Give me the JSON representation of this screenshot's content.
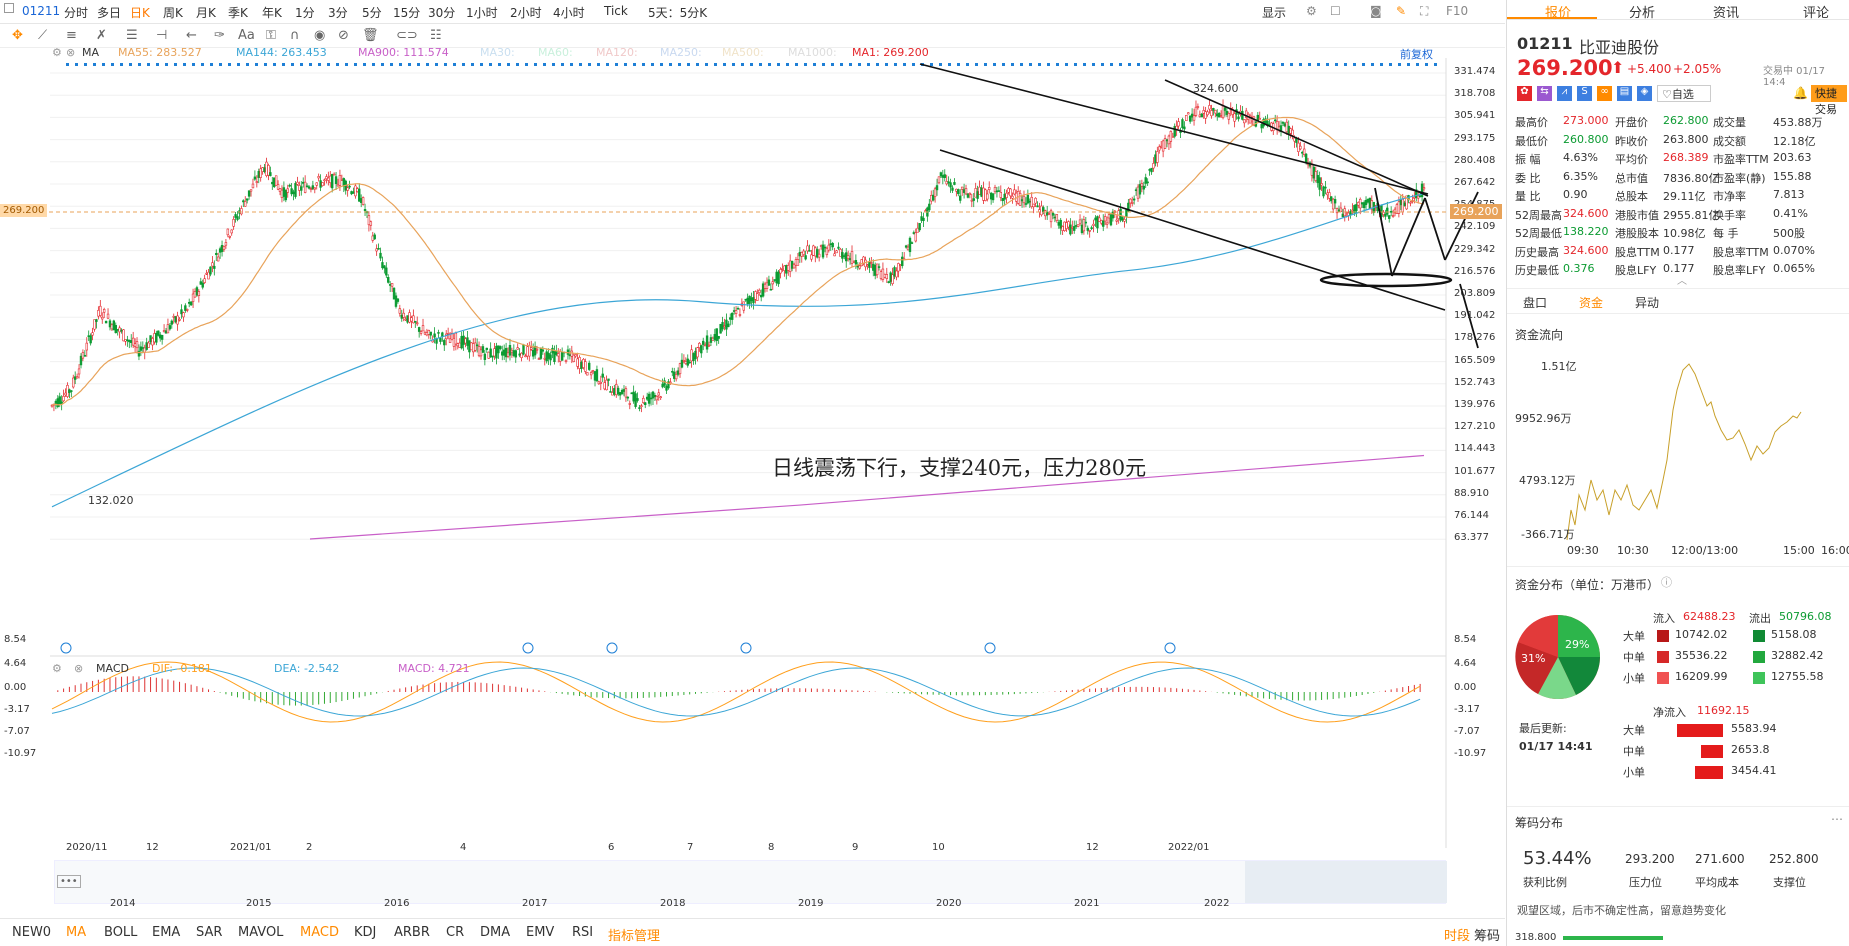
{
  "topbar": {
    "code": "01211",
    "periods": [
      "分时",
      "多日",
      "日K",
      "周K",
      "月K",
      "季K",
      "年K",
      "1分",
      "3分",
      "5分",
      "15分",
      "30分",
      "1小时",
      "2小时",
      "4小时",
      "Tick",
      "5天：5分K"
    ],
    "display_label": "显示",
    "f10": "F10"
  },
  "ma_legend": {
    "ma": "MA",
    "ma55": "MA55: 283.527",
    "ma144": "MA144: 263.453",
    "ma900": "MA900: 111.574",
    "ma30": "MA30:",
    "ma60": "MA60:",
    "ma120": "MA120:",
    "ma250": "MA250:",
    "ma500": "MA500:",
    "ma1000": "MA1000:",
    "ma1": "MA1: 269.200",
    "adjust": "前复权"
  },
  "price_axis": [
    "331.474",
    "318.708",
    "305.941",
    "293.175",
    "280.408",
    "267.642",
    "254.875",
    "242.109",
    "229.342",
    "216.576",
    "203.809",
    "191.042",
    "178.276",
    "165.509",
    "152.743",
    "139.976",
    "127.210",
    "114.443",
    "101.677",
    "88.910",
    "76.144",
    "63.377"
  ],
  "last_price_tag": "269.200",
  "annotations": {
    "high": "324.600",
    "low": "132.020",
    "note": "日线震荡下行，支撑240元，压力280元"
  },
  "macd_legend": {
    "name": "MACD",
    "dif": "DIF: -0.181",
    "dea": "DEA: -2.542",
    "macd": "MACD: 4.721"
  },
  "macd_axis": [
    "8.54",
    "4.64",
    "0.00",
    "-3.17",
    "-7.07",
    "-10.97"
  ],
  "time_axis": [
    "2020/11",
    "12",
    "2021/01",
    "2",
    "4",
    "6",
    "7",
    "8",
    "9",
    "10",
    "12",
    "2022/01"
  ],
  "year_axis": [
    "2014",
    "2015",
    "2016",
    "2017",
    "2018",
    "2019",
    "2020",
    "2021",
    "2022"
  ],
  "indicators": [
    "NEW0",
    "MA",
    "BOLL",
    "EMA",
    "SAR",
    "MAVOL",
    "MACD",
    "KDJ",
    "ARBR",
    "CR",
    "DMA",
    "EMV",
    "RSI",
    "指标管理"
  ],
  "bottom_right": {
    "timeshare": "时段",
    "chips": "筹码"
  },
  "panel": {
    "tabs": [
      "报价",
      "分析",
      "资讯",
      "评论"
    ],
    "code": "01211",
    "name": "比亚迪股份",
    "status": "交易中 01/17 14:4",
    "price": "269.200",
    "arrow": "⬆",
    "change": "+5.400",
    "pct": "+2.05%",
    "watch": "自选",
    "quick_trade": "快捷交易",
    "quotes": [
      [
        [
          "最高价",
          "273.000",
          "red"
        ],
        [
          "开盘价",
          "262.800",
          "green"
        ],
        [
          "成交量",
          "453.88万",
          ""
        ]
      ],
      [
        [
          "最低价",
          "260.800",
          "green"
        ],
        [
          "昨收价",
          "263.800",
          ""
        ],
        [
          "成交额",
          "12.18亿",
          ""
        ]
      ],
      [
        [
          "振  幅",
          "4.63%",
          ""
        ],
        [
          "平均价",
          "268.389",
          "red"
        ],
        [
          "市盈率TTM",
          "203.63",
          ""
        ]
      ],
      [
        [
          "委  比",
          "6.35%",
          ""
        ],
        [
          "总市值",
          "7836.80亿",
          ""
        ],
        [
          "市盈率(静)",
          "155.88",
          ""
        ]
      ],
      [
        [
          "量  比",
          "0.90",
          ""
        ],
        [
          "总股本",
          "29.11亿",
          ""
        ],
        [
          "市净率",
          "7.813",
          ""
        ]
      ],
      [
        [
          "52周最高",
          "324.600",
          "red"
        ],
        [
          "港股市值",
          "2955.81亿",
          ""
        ],
        [
          "换手率",
          "0.41%",
          ""
        ]
      ],
      [
        [
          "52周最低",
          "138.220",
          "green"
        ],
        [
          "港股股本",
          "10.98亿",
          ""
        ],
        [
          "每  手",
          "500股",
          ""
        ]
      ],
      [
        [
          "历史最高",
          "324.600",
          "red"
        ],
        [
          "股息TTM",
          "0.177",
          ""
        ],
        [
          "股息率TTM",
          "0.070%",
          ""
        ]
      ],
      [
        [
          "历史最低",
          "0.376",
          "green"
        ],
        [
          "股息LFY",
          "0.177",
          ""
        ],
        [
          "股息率LFY",
          "0.065%",
          ""
        ]
      ]
    ],
    "subtabs": [
      "盘口",
      "资金",
      "异动"
    ],
    "flow_title": "资金流向",
    "flow_yaxis": [
      "1.51亿",
      "9952.96万",
      "4793.12万",
      "-366.71万"
    ],
    "flow_xaxis": [
      "09:30",
      "10:30",
      "12:00/13:00",
      "15:00",
      "16:00"
    ],
    "dist_title": "资金分布（单位：万港币）",
    "pie_labels": [
      "31%",
      "29%"
    ],
    "inflow_label": "流入",
    "inflow_total": "62488.23",
    "outflow_label": "流出",
    "outflow_total": "50796.08",
    "dist_rows": [
      [
        "大单",
        "10742.02",
        "5158.08"
      ],
      [
        "中单",
        "35536.22",
        "32882.42"
      ],
      [
        "小单",
        "16209.99",
        "12755.58"
      ]
    ],
    "net_label": "净流入",
    "net_total": "11692.15",
    "update_label": "最后更新:",
    "update_time": "01/17 14:41",
    "net_rows": [
      [
        "大单",
        "5583.94"
      ],
      [
        "中单",
        "2653.8"
      ],
      [
        "小单",
        "3454.41"
      ]
    ],
    "chip_title": "筹码分布",
    "chip_vals": [
      [
        "53.44%",
        "获利比例"
      ],
      [
        "293.200",
        "压力位"
      ],
      [
        "271.600",
        "平均成本"
      ],
      [
        "252.800",
        "支撑位"
      ]
    ],
    "chip_note": "观望区域，后市不确定性高，留意趋势变化",
    "chip_price": "318.800"
  },
  "colors": {
    "up": "#e4262b",
    "down": "#0c9b32",
    "ma55": "#e8a35a",
    "ma144": "#3ca6d6",
    "ma900": "#c85fc8",
    "accent": "#ff8a00"
  }
}
